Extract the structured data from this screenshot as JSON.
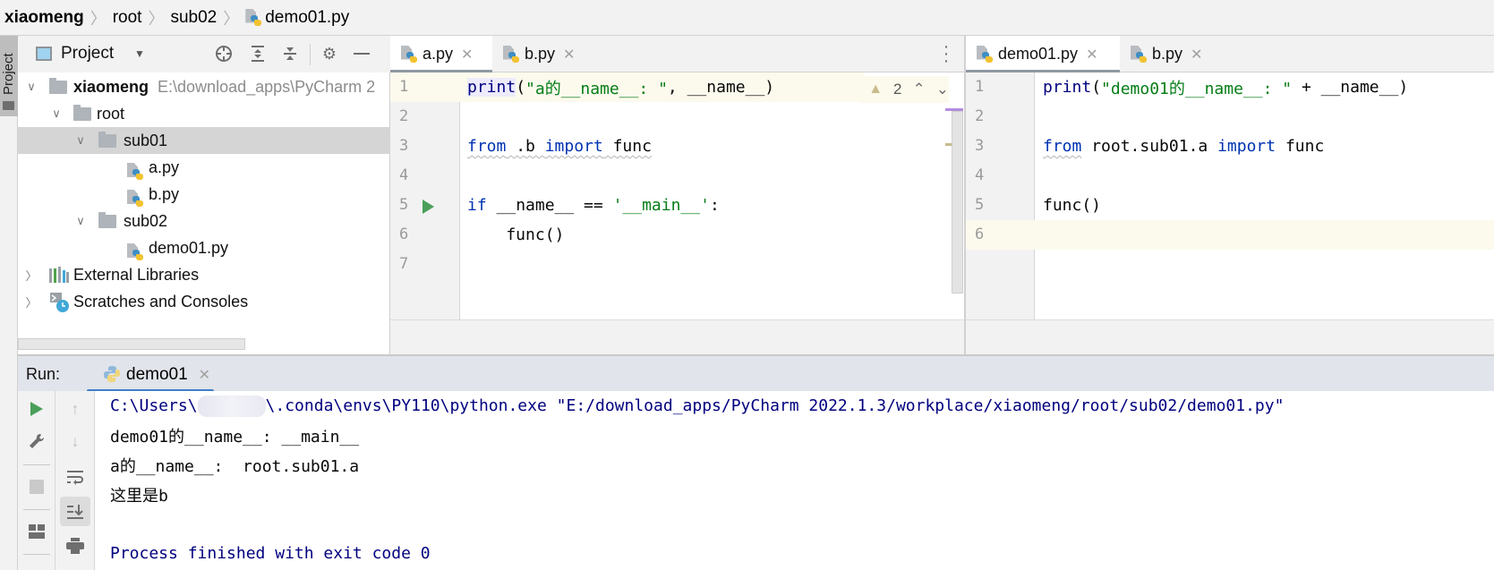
{
  "breadcrumb": {
    "items": [
      "xiaomeng",
      "root",
      "sub02",
      "demo01.py"
    ]
  },
  "left_strip": {
    "label": "Project"
  },
  "project_panel": {
    "title": "Project",
    "toolbar_icons": [
      "locate-icon",
      "expand-all-icon",
      "collapse-all-icon",
      "gear-icon",
      "hide-icon"
    ],
    "tree": [
      {
        "label": "xiaomeng",
        "path": "E:\\download_apps\\PyCharm 2",
        "type": "folder",
        "expanded": true,
        "bold": true
      },
      {
        "label": "root",
        "type": "folder",
        "expanded": true
      },
      {
        "label": "sub01",
        "type": "folder",
        "expanded": true,
        "selected": true
      },
      {
        "label": "a.py",
        "type": "python-file"
      },
      {
        "label": "b.py",
        "type": "python-file"
      },
      {
        "label": "sub02",
        "type": "folder",
        "expanded": true
      },
      {
        "label": "demo01.py",
        "type": "python-file"
      },
      {
        "label": "External Libraries",
        "type": "libraries",
        "expanded": false
      },
      {
        "label": "Scratches and Consoles",
        "type": "scratches",
        "expanded": false
      }
    ]
  },
  "left_editor": {
    "tabs": [
      {
        "label": "a.py",
        "active": true
      },
      {
        "label": "b.py",
        "active": false
      }
    ],
    "warning_count": "2",
    "line_numbers": [
      "1",
      "2",
      "3",
      "4",
      "5",
      "6",
      "7"
    ],
    "code": {
      "l1": {
        "fn": "print",
        "open": "(",
        "str": "\"a的__name__: \"",
        "rest": ", __name__)"
      },
      "l3": {
        "kw1": "from",
        "mod": " .b ",
        "kw2": "import",
        "name": " func"
      },
      "l5": {
        "kw": "if",
        "mid": " __name__ == ",
        "str": "'__main__'",
        "end": ":"
      },
      "l6": {
        "text": "    func()"
      }
    }
  },
  "right_editor": {
    "tabs": [
      {
        "label": "demo01.py",
        "active": true
      },
      {
        "label": "b.py",
        "active": false
      }
    ],
    "line_numbers": [
      "1",
      "2",
      "3",
      "4",
      "5",
      "6"
    ],
    "code": {
      "l1": {
        "fn": "print",
        "open": "(",
        "str": "\"demo01的__name__: \"",
        "rest": " + __name__)"
      },
      "l3": {
        "kw1": "from",
        "mod": " root.sub01.a ",
        "kw2": "import",
        "name": " func"
      },
      "l5": {
        "text": "func()"
      }
    }
  },
  "run_panel": {
    "label": "Run:",
    "tab_label": "demo01",
    "console": {
      "cmd_prefix": "C:\\Users\\",
      "cmd_suffix": "\\.conda\\envs\\PY110\\python.exe \"E:/download_apps/PyCharm 2022.1.3/workplace/xiaomeng/root/sub02/demo01.py\"",
      "lines": [
        "demo01的__name__: __main__",
        "a的__name__:  root.sub01.a",
        "这里是b"
      ],
      "exit": "Process finished with exit code 0"
    }
  },
  "colors": {
    "keyword": "#0033b3",
    "string": "#067d17",
    "builtin": "#000080",
    "console_cmd": "#00007f",
    "run_icon": "#4aa05a",
    "tab_underline": "#3f7ecb"
  }
}
